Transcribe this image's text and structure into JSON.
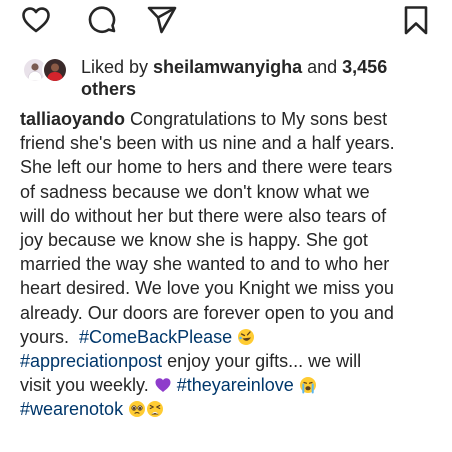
{
  "actions": {
    "like": "heart-icon",
    "comment": "comment-icon",
    "share": "send-icon",
    "save": "bookmark-icon"
  },
  "likes": {
    "prefix": "Liked by ",
    "user": "sheilamwanyigha",
    "and": " and ",
    "count": "3,456",
    "others": "others"
  },
  "caption": {
    "username": "talliaoyando",
    "lines": [
      " Congratulations to My sons best",
      "friend she's been with us nine and a half years.",
      "She left our home to hers and there were tears",
      "of sadness because we don't know what we",
      "will do without her but there were also tears of",
      "joy because we know she is happy. She got",
      "married the way she wanted to and to who her",
      "heart desired. We love you Knight we miss you",
      "already. Our doors are forever open to you and",
      "yours.  "
    ],
    "tag_comeback": "#ComeBackPlease",
    "tag_appreciation": "#appreciationpost",
    "text_gifts": " enjoy your gifts... we will",
    "text_visit": "visit you weekly. ",
    "tag_inlove": "#theyareinlove",
    "tag_notok": "#wearenotok"
  },
  "colors": {
    "text": "#262626",
    "hashtag": "#00376b",
    "heart_emoji": "#8e3ccb",
    "emoji_yellow": "#ffcc33"
  }
}
